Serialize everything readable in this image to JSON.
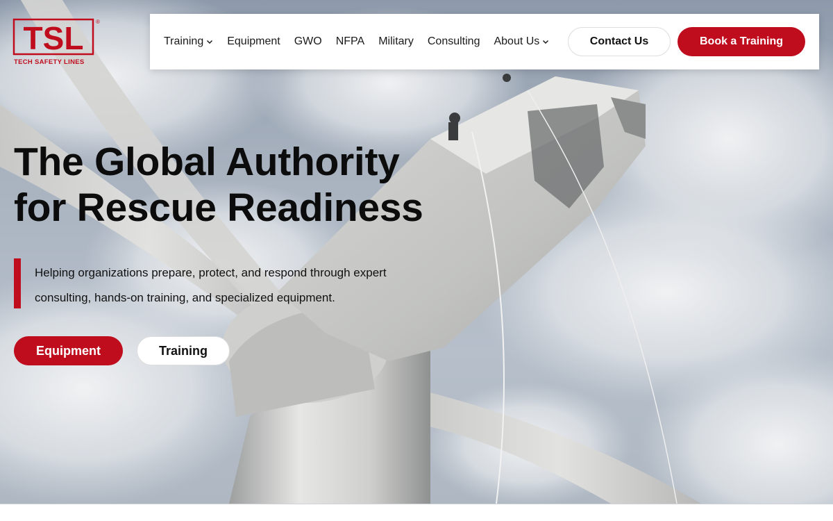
{
  "brand": {
    "logo_text": "TSL",
    "logo_tagline": "TECH SAFETY LINES",
    "logo_reg": "®",
    "color_red": "#c00d1e"
  },
  "nav": {
    "items": [
      {
        "label": "Training",
        "has_dropdown": true
      },
      {
        "label": "Equipment",
        "has_dropdown": false
      },
      {
        "label": "GWO",
        "has_dropdown": false
      },
      {
        "label": "NFPA",
        "has_dropdown": false
      },
      {
        "label": "Military",
        "has_dropdown": false
      },
      {
        "label": "Consulting",
        "has_dropdown": false
      },
      {
        "label": "About Us",
        "has_dropdown": true
      }
    ],
    "contact_label": "Contact Us",
    "book_label": "Book a Training",
    "dropdown_icon": "chevron-down-icon"
  },
  "hero": {
    "headline_line1": "The Global Authority",
    "headline_line2": "for Rescue Readiness",
    "subtext_line1": "Helping organizations prepare, protect, and respond through expert",
    "subtext_line2": "consulting, hands-on training, and specialized equipment.",
    "primary_button": "Equipment",
    "secondary_button": "Training",
    "background": "wind-turbine-photo"
  }
}
